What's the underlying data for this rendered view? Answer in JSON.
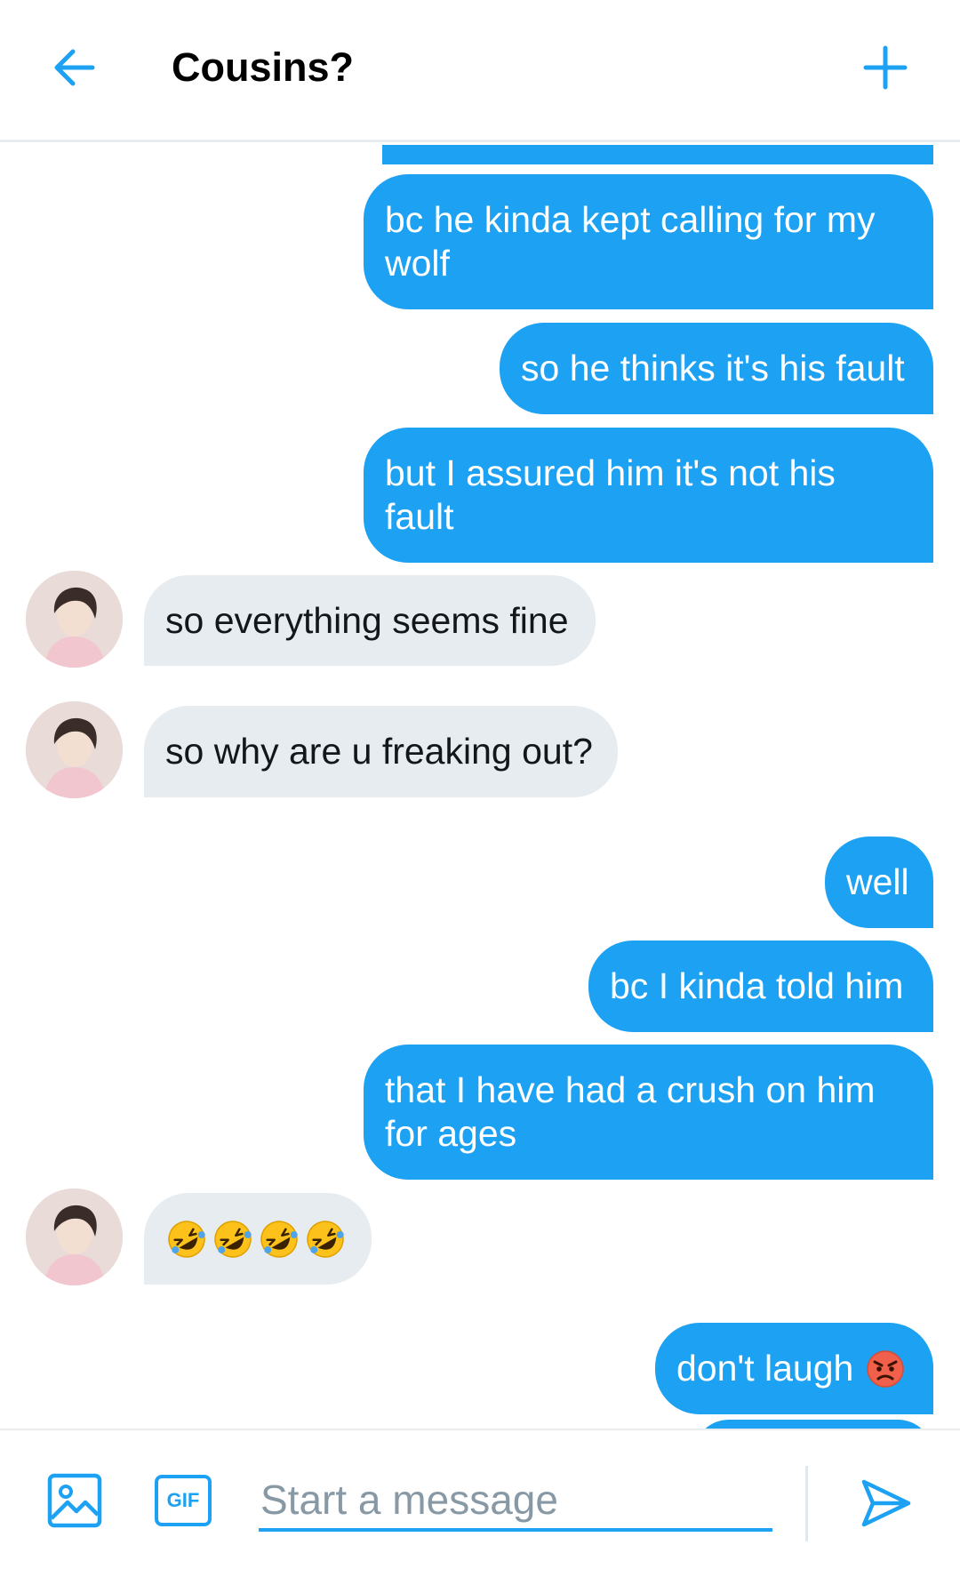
{
  "header": {
    "title": "Cousins?",
    "back_icon": "arrow-left-icon",
    "add_icon": "plus-icon"
  },
  "colors": {
    "accent": "#1da1f2",
    "received_bubble": "#e6ecf0",
    "received_text": "#14171a",
    "sent_text": "#ffffff"
  },
  "messages": [
    {
      "from": "me",
      "text": "bc he kinda kept calling for my wolf"
    },
    {
      "from": "me",
      "text": "so he thinks it's his fault"
    },
    {
      "from": "me",
      "text": "but I assured him it's not his fault"
    },
    {
      "from": "them",
      "text": "so everything seems fine"
    },
    {
      "from": "them",
      "text": "so why are u freaking out?"
    },
    {
      "from": "me",
      "text": "well"
    },
    {
      "from": "me",
      "text": "bc I kinda told him"
    },
    {
      "from": "me",
      "text": "that I have had a crush on him for ages"
    },
    {
      "from": "them",
      "emoji": [
        "rolling-on-floor-laughing",
        "rolling-on-floor-laughing",
        "rolling-on-floor-laughing",
        "rolling-on-floor-laughing"
      ]
    },
    {
      "from": "me",
      "text": "don't laugh",
      "emoji": "angry-face"
    }
  ],
  "composer": {
    "placeholder": "Start a message",
    "gif_label": "GIF",
    "media_icon": "image-icon",
    "send_icon": "send-icon"
  }
}
